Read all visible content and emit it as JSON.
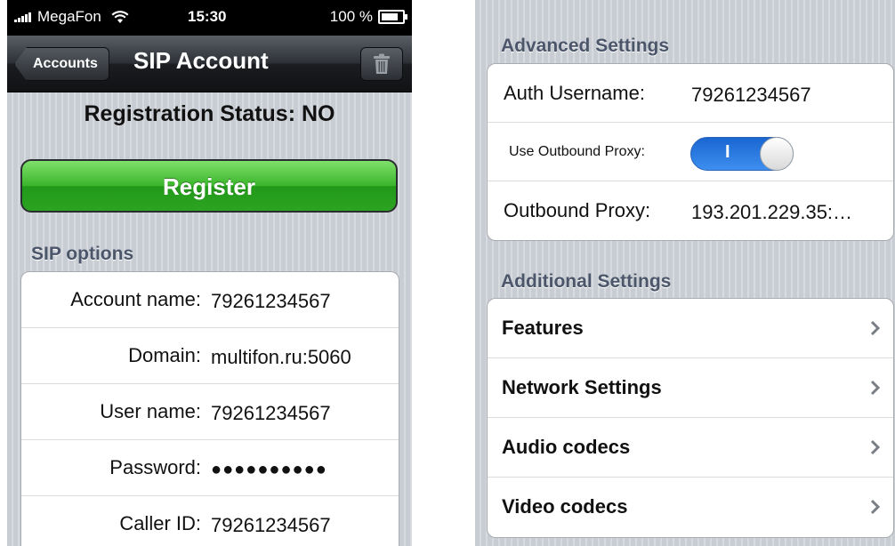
{
  "status_bar": {
    "carrier": "MegaFon",
    "time": "15:30",
    "battery": "100 %"
  },
  "nav": {
    "back_label": "Accounts",
    "title": "SIP Account"
  },
  "registration_status": "Registration Status: NO",
  "register_label": "Register",
  "sip_options": {
    "header": "SIP options",
    "rows": [
      {
        "label": "Account name:",
        "value": "79261234567"
      },
      {
        "label": "Domain:",
        "value": "multifon.ru:5060"
      },
      {
        "label": "User name:",
        "value": "79261234567"
      },
      {
        "label": "Password:",
        "value": "●●●●●●●●●●"
      },
      {
        "label": "Caller ID:",
        "value": "79261234567"
      }
    ]
  },
  "advanced": {
    "header": "Advanced Settings",
    "auth_label": "Auth Username:",
    "auth_value": "79261234567",
    "proxy_toggle_label": "Use Outbound Proxy:",
    "proxy_toggle_on": true,
    "proxy_toggle_text": "I",
    "proxy_label": "Outbound Proxy:",
    "proxy_value": "193.201.229.35:…"
  },
  "additional": {
    "header": "Additional Settings",
    "items": [
      {
        "label": "Features"
      },
      {
        "label": "Network Settings"
      },
      {
        "label": "Audio codecs"
      },
      {
        "label": "Video codecs"
      }
    ]
  },
  "colors": {
    "register_green": "#3bb52c",
    "toggle_blue": "#1a66d1",
    "section_header": "#4c566a"
  },
  "icons": [
    "signal-bars-icon",
    "wifi-icon",
    "battery-icon",
    "trash-icon",
    "chevron-right-icon"
  ]
}
